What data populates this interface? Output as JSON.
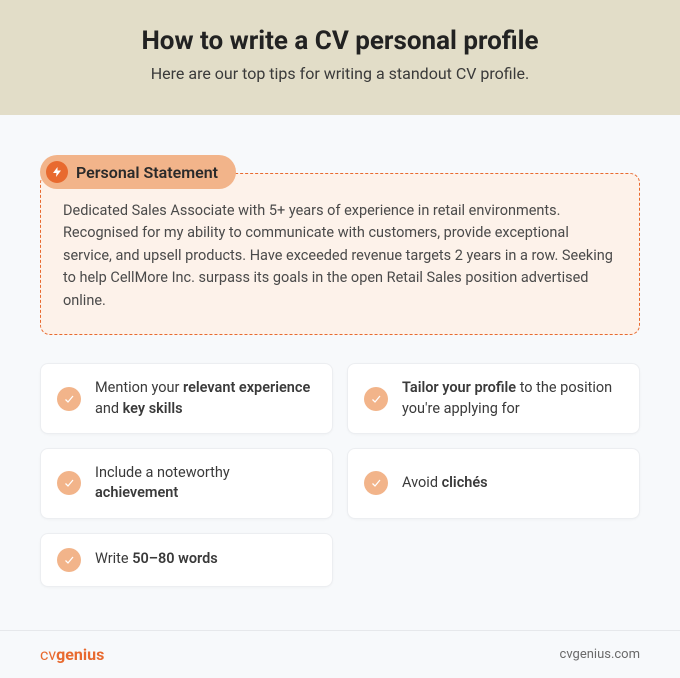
{
  "header": {
    "title": "How to write a CV personal profile",
    "subtitle": "Here are our top tips for writing a standout CV profile."
  },
  "tag": {
    "label": "Personal Statement"
  },
  "statement": "Dedicated Sales Associate with 5+ years of experience in retail environments. Recognised for my ability to communicate with customers, provide exceptional service, and upsell products. Have exceeded revenue targets 2 years in a row. Seeking to help CellMore Inc. surpass its goals in the open Retail Sales position advertised online.",
  "tips": [
    {
      "html": "Mention your <b>relevant experience</b> and <b>key skills</b>"
    },
    {
      "html": "<b>Tailor your profile</b> to the position you're applying for"
    },
    {
      "html": "Include a noteworthy <b>achievement</b>"
    },
    {
      "html": "Avoid <b>clichés</b>"
    },
    {
      "html": "Write <b>50–80 words</b>"
    }
  ],
  "footer": {
    "logo_prefix": "cv",
    "logo_bold": "genius",
    "url": "cvgenius.com"
  }
}
